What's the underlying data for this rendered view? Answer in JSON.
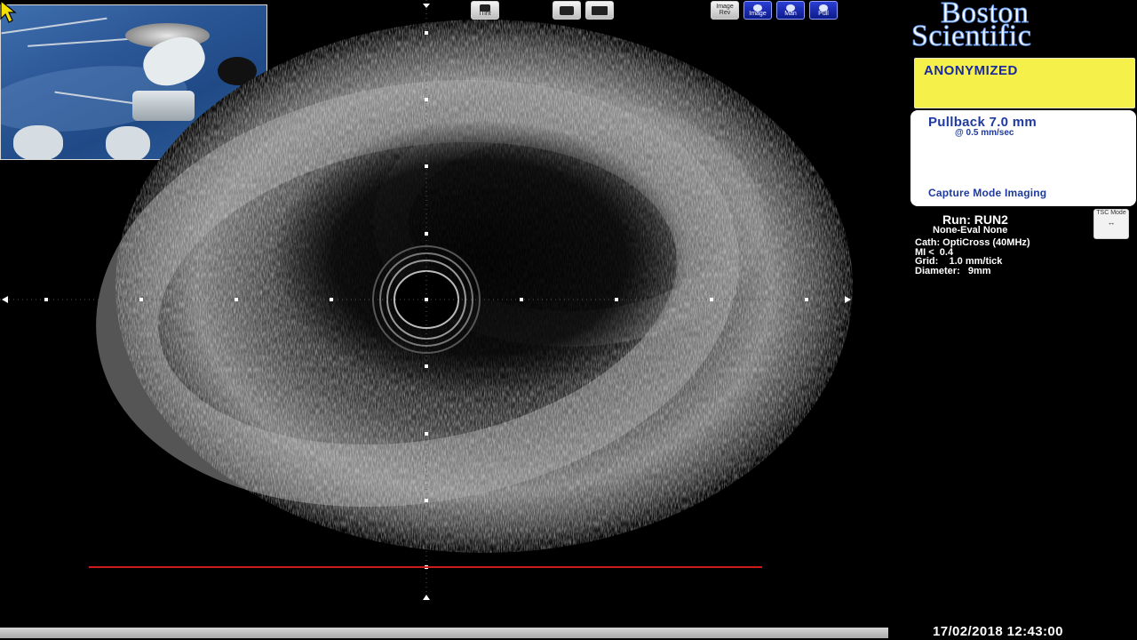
{
  "toolbar": {
    "buttons": [
      {
        "name": "itint-button",
        "label": "ITint"
      },
      {
        "name": "print-button",
        "label": ""
      },
      {
        "name": "video-button",
        "label": ""
      },
      {
        "name": "image-review-button",
        "label": "Image Rev"
      },
      {
        "name": "image-button",
        "label": "Image"
      },
      {
        "name": "manual-button",
        "label": "Man"
      },
      {
        "name": "pull-button",
        "label": "Pull"
      }
    ]
  },
  "brand": {
    "line1": "Boston",
    "line2": "Scientific",
    "color": "#3b77d8"
  },
  "patient": {
    "name": "ANONYMIZED"
  },
  "pullback": {
    "title": "Pullback 7.0 mm",
    "rate": "@ 0.5 mm/sec",
    "mode": "Capture Mode Imaging"
  },
  "run": {
    "title": "Run: RUN2",
    "eval": "None-Eval None"
  },
  "tsc_mode": {
    "label": "TSC Mode"
  },
  "params": {
    "cath": "Cath: OptiCross (40MHz)",
    "mi": "MI <  0.4",
    "grid": "Grid:    1.0 mm/tick",
    "diameter": "Diameter:   9mm"
  },
  "datetime": "17/02/2018 12:43:00",
  "colors": {
    "background": "#000000",
    "patient_bg": "#f5f04a",
    "panel_text": "#1e3a9e",
    "tick_marks": "#ffffff",
    "red_line": "#cc1a1a",
    "cursor": "#f4e000"
  }
}
